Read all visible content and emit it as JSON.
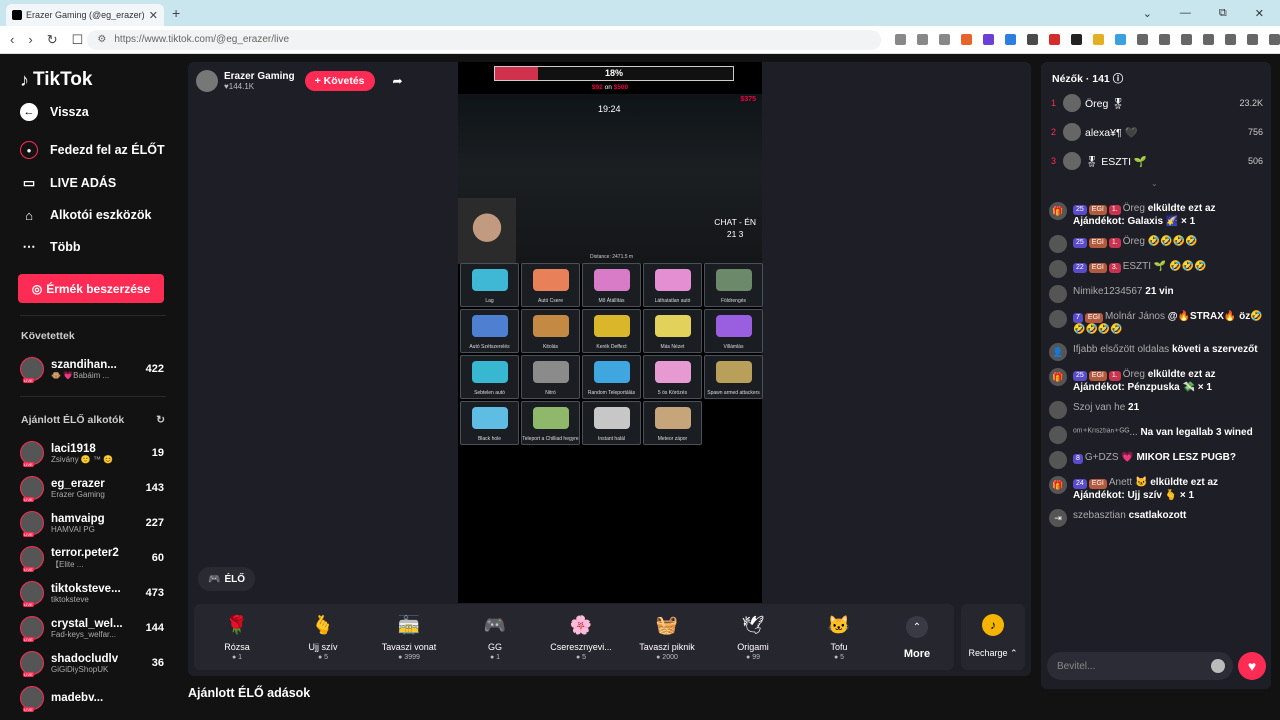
{
  "browser": {
    "tab_title": "Erazer Gaming (@eg_erazer) |",
    "url": "https://www.tiktok.com/@eg_erazer/live",
    "new_tab": "+",
    "win_min": "⌄",
    "win_restore": "—",
    "win_max": "⧉",
    "win_close": "✕"
  },
  "sidebar": {
    "logo": "TikTok",
    "back": "Vissza",
    "nav": [
      {
        "label": "Fedezd fel az ÉLŐT",
        "icon": "compass-icon"
      },
      {
        "label": "LIVE ADÁS",
        "icon": "camera-icon"
      },
      {
        "label": "Alkotói eszközök",
        "icon": "tools-icon"
      },
      {
        "label": "Több",
        "icon": "more-icon"
      }
    ],
    "coin_button": "Érmék beszerzése",
    "following_header": "Követettek",
    "following": [
      {
        "name": "szandihan...",
        "sub": "🐵 💗Babáim ...",
        "count": "422"
      }
    ],
    "recommended_header": "Ajánlott ÉLŐ alkotók",
    "recommended": [
      {
        "name": "laci1918",
        "sub": "Zsivány 🙂 ™ 😊",
        "count": "19"
      },
      {
        "name": "eg_erazer",
        "sub": "Erazer Gaming",
        "count": "143"
      },
      {
        "name": "hamvaipg",
        "sub": "HAMVAI PG",
        "count": "227"
      },
      {
        "name": "terror.peter2",
        "sub": "【Elite ...",
        "count": "60"
      },
      {
        "name": "tiktoksteve...",
        "sub": "tiktoksteve",
        "count": "473"
      },
      {
        "name": "crystal_wel...",
        "sub": "Fad-keys_welfar...",
        "count": "144"
      },
      {
        "name": "shadocludlv",
        "sub": "GiGiDiyShopUK",
        "count": "36"
      },
      {
        "name": "madebv...",
        "sub": "",
        "count": ""
      }
    ]
  },
  "stream": {
    "streamer_name": "Erazer Gaming",
    "likes": "♥144.1K",
    "follow": "+ Követés",
    "progress_pct": "18%",
    "progress_value": 0.18,
    "goal_current": "$92",
    "goal_mid": "on",
    "goal_target": "$500",
    "game_time": "19:24",
    "money": "$375",
    "chat_label": "CHAT - ÉN",
    "chat_nums": "21     3",
    "distance": "Distance: 2471.5 m",
    "live_label": "ÉLŐ",
    "gift_grid": [
      {
        "label": "Lag",
        "color": "#3fb8d6"
      },
      {
        "label": "Autó Csere",
        "color": "#e8805a"
      },
      {
        "label": "Mő Átállítás",
        "color": "#d97cc7"
      },
      {
        "label": "Láthatatlan autó",
        "color": "#e58fd3"
      },
      {
        "label": "Földrengés",
        "color": "#6c8a6a"
      },
      {
        "label": "Autó Szétszerelés",
        "color": "#4f7fd1"
      },
      {
        "label": "Kitolás",
        "color": "#c48a44"
      },
      {
        "label": "Kerék Deffect",
        "color": "#d9b62a"
      },
      {
        "label": "Más Nézet",
        "color": "#e2d15a"
      },
      {
        "label": "Villámlás",
        "color": "#9a5fe0"
      },
      {
        "label": "Sebtelen autó",
        "color": "#38b7d0"
      },
      {
        "label": "Nitró",
        "color": "#8b8b8b"
      },
      {
        "label": "Random Teleportálás",
        "color": "#3fa6e0"
      },
      {
        "label": "5 ös Körözés",
        "color": "#e79ad1"
      },
      {
        "label": "Spawn armed attackers",
        "color": "#b9a05a"
      },
      {
        "label": "Black hole",
        "color": "#5fbde3"
      },
      {
        "label": "Teleport a Chilliad hegyre",
        "color": "#8fb86a"
      },
      {
        "label": "Instant halál",
        "color": "#c7c7c7"
      },
      {
        "label": "Meteor zápor",
        "color": "#c7a57a"
      },
      {
        "label": "",
        "color": "#000000"
      }
    ]
  },
  "giftbar": {
    "items": [
      {
        "name": "Rózsa",
        "price": "1",
        "icon": "🌹"
      },
      {
        "name": "Ujj szív",
        "price": "5",
        "icon": "🫰"
      },
      {
        "name": "Tavaszi vonat",
        "price": "3999",
        "icon": "🚋"
      },
      {
        "name": "GG",
        "price": "1",
        "icon": "🎮"
      },
      {
        "name": "Cseresznyevi...",
        "price": "5",
        "icon": "🌸"
      },
      {
        "name": "Tavaszi piknik",
        "price": "2000",
        "icon": "🧺"
      },
      {
        "name": "Origami",
        "price": "99",
        "icon": "🕊"
      },
      {
        "name": "Tofu",
        "price": "5",
        "icon": "🐱"
      }
    ],
    "more_label": "More",
    "recharge_label": "Recharge ⌃"
  },
  "recommended_section": "Ajánlott ÉLŐ adások",
  "chat": {
    "viewers": "Nézők · 141 ⓘ",
    "ranking": [
      {
        "rank": "1",
        "name": "Öreg 🎖",
        "score": "23.2K"
      },
      {
        "rank": "2",
        "name": "alexa¥¶ 🖤",
        "score": "756"
      },
      {
        "rank": "3",
        "name": "🎖 ESZTI 🌱",
        "score": "506"
      }
    ],
    "messages": [
      {
        "user": "Öreg",
        "badges": [
          "25",
          "EGI",
          "1."
        ],
        "text": "elküldte ezt az Ajándékot: Galaxis 🌠 × 1",
        "icon": "gift-icon"
      },
      {
        "user": "Öreg",
        "badges": [
          "25",
          "EGI",
          "1."
        ],
        "text": "🤣🤣🤣🤣",
        "icon": "avatar"
      },
      {
        "user": "ESZTI 🌱",
        "badges": [
          "22",
          "EGI",
          "3."
        ],
        "text": "🤣🤣🤣",
        "icon": "avatar"
      },
      {
        "user": "Nimike1234567",
        "badges": [],
        "text": "21 vin",
        "icon": "avatar"
      },
      {
        "user": "Molnár János",
        "badges": [
          "7",
          "EGI"
        ],
        "text": "@🔥STRAX🔥 öz🤣🤣🤣🤣🤣",
        "icon": "avatar"
      },
      {
        "user": "Ifjabb elsőzött oldalas",
        "badges": [],
        "text": "követi a szervezőt",
        "icon": "user-follow-icon"
      },
      {
        "user": "Öreg",
        "badges": [
          "25",
          "EGI",
          "1."
        ],
        "text": "elküldte ezt az Ajándékot: Pénzpuska 💸 × 1",
        "icon": "gift-icon"
      },
      {
        "user": "Szoj van he",
        "badges": [],
        "text": "21",
        "icon": "avatar"
      },
      {
        "user": "ᵒᵐ⁺ᴷʳᶦˢᶻᵗᶦᵃⁿ⁺ᴳᴳ...",
        "badges": [],
        "text": "Na van legallab 3 wined",
        "icon": "avatar"
      },
      {
        "user": "G+DZS 💗",
        "badges": [
          "8"
        ],
        "text": "MIKOR LESZ PUGB?",
        "icon": "avatar"
      },
      {
        "user": "Anett 🐱",
        "badges": [
          "24",
          "EGI"
        ],
        "text": "elküldte ezt az Ajándékot: Ujj szív 🫰 × 1",
        "icon": "gift-icon"
      },
      {
        "user": "szebasztian",
        "badges": [],
        "text": "csatlakozott",
        "icon": "join-icon"
      }
    ],
    "input_placeholder": "Bevitel...",
    "colors": {
      "accent": "#fe2c55",
      "panel": "#1e1e26"
    }
  }
}
